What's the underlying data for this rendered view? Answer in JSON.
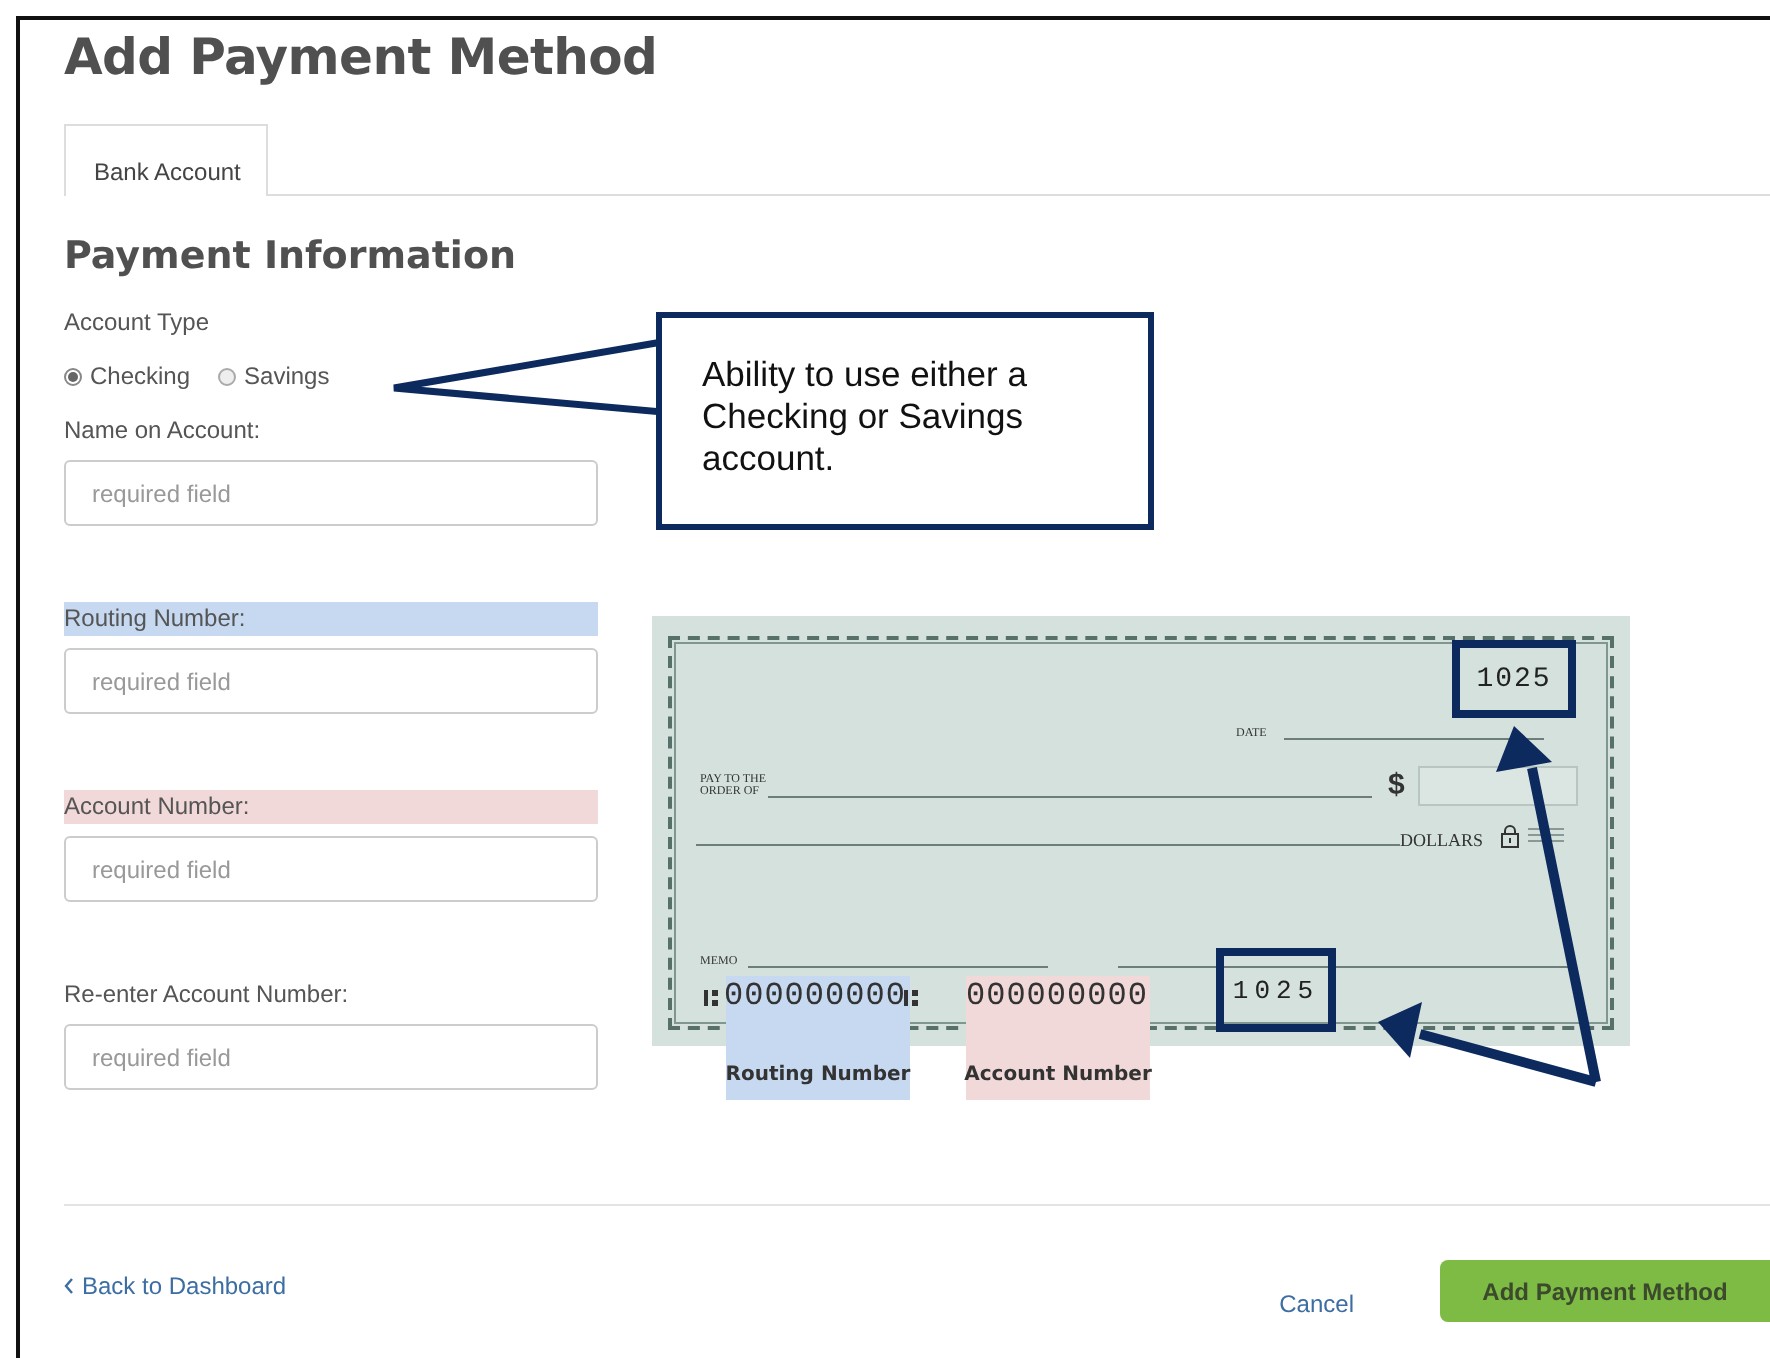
{
  "page": {
    "title": "Add Payment Method"
  },
  "tabs": [
    {
      "label": "Bank Account",
      "selected": true
    }
  ],
  "section_title": "Payment Information",
  "account_type": {
    "label": "Account Type",
    "options": [
      {
        "label": "Checking",
        "selected": true
      },
      {
        "label": "Savings",
        "selected": false
      }
    ]
  },
  "fields": [
    {
      "label": "Name on Account:",
      "placeholder": "required field"
    },
    {
      "label": "Routing Number:",
      "placeholder": "required field",
      "color": "#c6d9f0"
    },
    {
      "label": "Account Number:",
      "placeholder": "required field",
      "color": "#f2d9d9"
    },
    {
      "label": "Re-enter Account Number:",
      "placeholder": "required field"
    }
  ],
  "callout": {
    "text": "Ability to use either a Checking or Savings account."
  },
  "check": {
    "number": "1025",
    "date_label": "DATE",
    "pay_label": "PAY TO THE ORDER OF",
    "currency": "$",
    "dollars_label": "DOLLARS",
    "memo_label": "MEMO",
    "routing_digits": "000000000",
    "account_digits": "000000000",
    "micr_number": "1025",
    "legend": [
      {
        "text": "Routing Number",
        "color": "#c6d9f0"
      },
      {
        "text": "Account Number",
        "color": "#f2d9d9"
      }
    ]
  },
  "footer": {
    "back_link": "Back to Dashboard",
    "cancel": "Cancel",
    "submit": "Add Payment Method"
  }
}
